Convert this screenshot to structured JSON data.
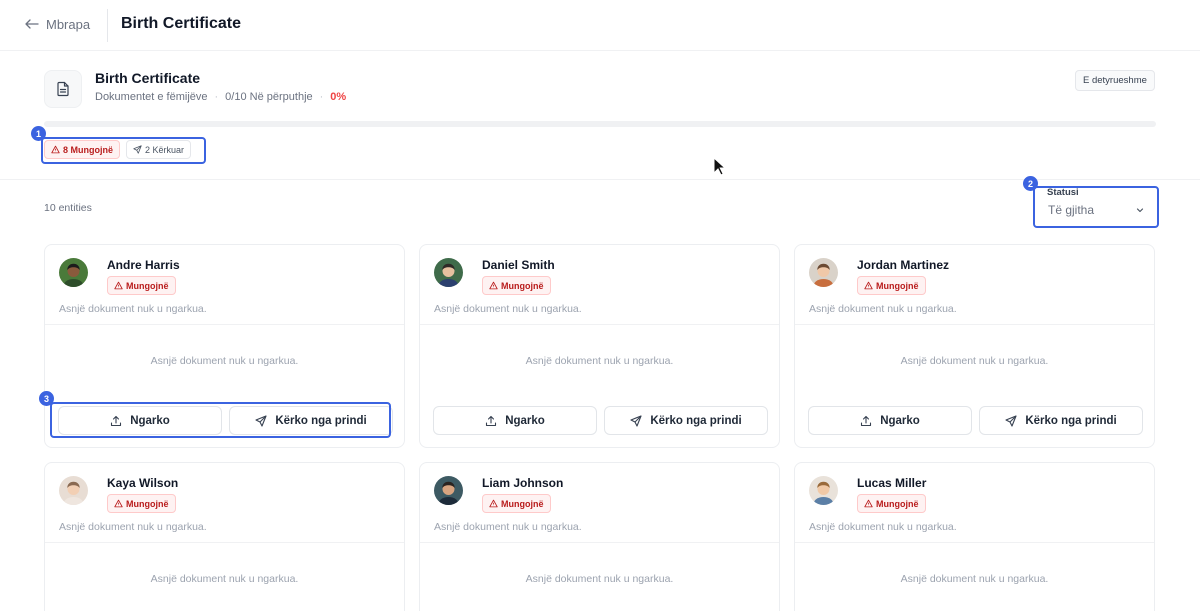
{
  "header": {
    "back_label": "Mbrapa",
    "title": "Birth Certificate"
  },
  "document": {
    "title": "Birth Certificate",
    "category": "Dokumentet e fëmijëve",
    "match_count": "0/10 Në përputhje",
    "percent": "0%",
    "progress_fraction": 0,
    "required_badge": "E detyrueshme"
  },
  "chips": {
    "missing": "8 Mungojnë",
    "requested": "2 Kërkuar"
  },
  "entities_label": "10 entities",
  "status_filter": {
    "label": "Statusi",
    "value": "Të gjitha"
  },
  "people": [
    {
      "name": "Andre Harris",
      "status": "Mungojnë",
      "subtitle": "Asnjë dokument nuk u ngarkua.",
      "empty_text": "Asnjë dokument nuk u ngarkua.",
      "upload_label": "Ngarko",
      "request_label": "Kërko nga prindi"
    },
    {
      "name": "Daniel Smith",
      "status": "Mungojnë",
      "subtitle": "Asnjë dokument nuk u ngarkua.",
      "empty_text": "Asnjë dokument nuk u ngarkua.",
      "upload_label": "Ngarko",
      "request_label": "Kërko nga prindi"
    },
    {
      "name": "Jordan Martinez",
      "status": "Mungojnë",
      "subtitle": "Asnjë dokument nuk u ngarkua.",
      "empty_text": "Asnjë dokument nuk u ngarkua.",
      "upload_label": "Ngarko",
      "request_label": "Kërko nga prindi"
    },
    {
      "name": "Kaya Wilson",
      "status": "Mungojnë",
      "subtitle": "Asnjë dokument nuk u ngarkua.",
      "empty_text": "Asnjë dokument nuk u ngarkua."
    },
    {
      "name": "Liam Johnson",
      "status": "Mungojnë",
      "subtitle": "Asnjë dokument nuk u ngarkua.",
      "empty_text": "Asnjë dokument nuk u ngarkua."
    },
    {
      "name": "Lucas Miller",
      "status": "Mungojnë",
      "subtitle": "Asnjë dokument nuk u ngarkua.",
      "empty_text": "Asnjë dokument nuk u ngarkua."
    }
  ],
  "annotations": [
    "1",
    "2",
    "3"
  ],
  "icons": {
    "back": "arrow-left-icon",
    "document": "file-text-icon",
    "warning": "alert-triangle-icon",
    "send": "send-icon",
    "upload": "upload-icon",
    "dropdown": "chevron-down-icon"
  },
  "colors": {
    "danger": "#ef4444",
    "danger_bg": "#fef2f2",
    "annotation": "#3b63e0"
  }
}
